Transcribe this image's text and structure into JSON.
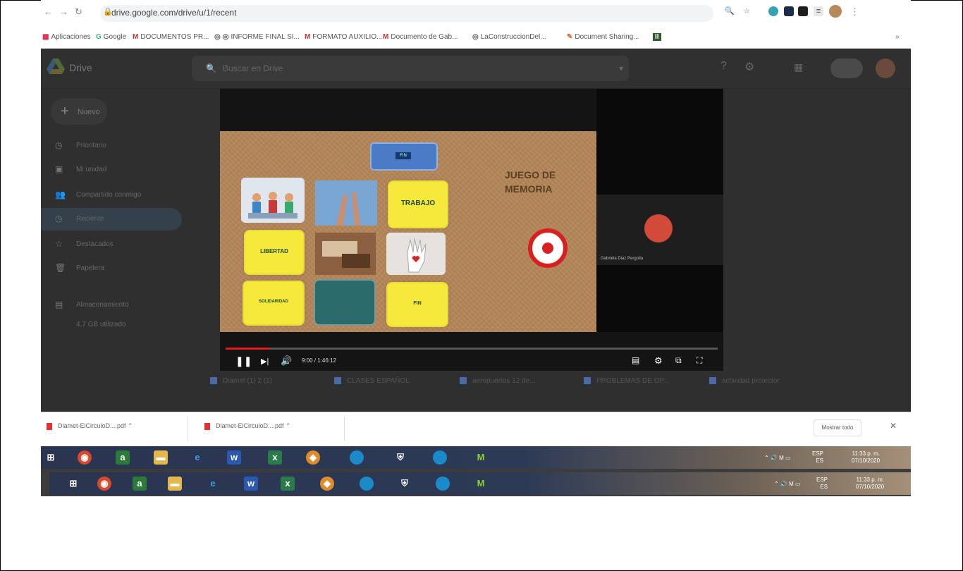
{
  "browser": {
    "url": "drive.google.com/drive/u/1/recent",
    "bookmarks": [
      {
        "label": "Aplicaciones"
      },
      {
        "label": "Google"
      },
      {
        "label": "DOCUMENTOS PR..."
      },
      {
        "label": "INFORME FINAL SI..."
      },
      {
        "label": "FORMATO AUXILIO..."
      },
      {
        "label": "Documento de Gab..."
      },
      {
        "label": "LaConstruccionDel..."
      },
      {
        "label": "Document Sharing..."
      }
    ]
  },
  "drive": {
    "app_name": "Drive",
    "search_placeholder": "Buscar en Drive",
    "new_label": "Nuevo",
    "sidebar": [
      {
        "label": "Prioritario"
      },
      {
        "label": "Mi unidad"
      },
      {
        "label": "Compartido conmigo"
      },
      {
        "label": "Reciente"
      },
      {
        "label": "Destacados"
      },
      {
        "label": "Papelera"
      },
      {
        "label": "Almacenamiento"
      },
      {
        "label": "4,7 GB utilizado"
      }
    ],
    "files": [
      {
        "label": "Diamet (1) 2 (1)"
      },
      {
        "label": "CLASES ESPAÑOL"
      },
      {
        "label": "aeropuertos 12 de..."
      },
      {
        "label": "PROBLEMAS DE OP..."
      },
      {
        "label": "actividad protector"
      }
    ]
  },
  "video": {
    "slide_title": "JUEGO DE MEMORIA",
    "top_card": "FIN",
    "cards": [
      {
        "label": "TRABAJO"
      },
      {
        "label": "LIBERTAD"
      },
      {
        "label": "SOLIDARIDAD"
      },
      {
        "label": "FIN"
      }
    ],
    "participant_name": "Gabriela Diaz Pergolla",
    "time": "9:00 / 1:46:12",
    "progress": 0.09
  },
  "downloads": {
    "items": [
      {
        "label": "Diamet-ElCirculoD....pdf"
      },
      {
        "label": "Diamet-ElCirculoD....pdf"
      }
    ],
    "show_all": "Mostrar todo"
  },
  "taskbar": {
    "lang": "ESP",
    "lang2": "ES",
    "time": "11:33 p. m.",
    "date": "07/10/2020"
  }
}
